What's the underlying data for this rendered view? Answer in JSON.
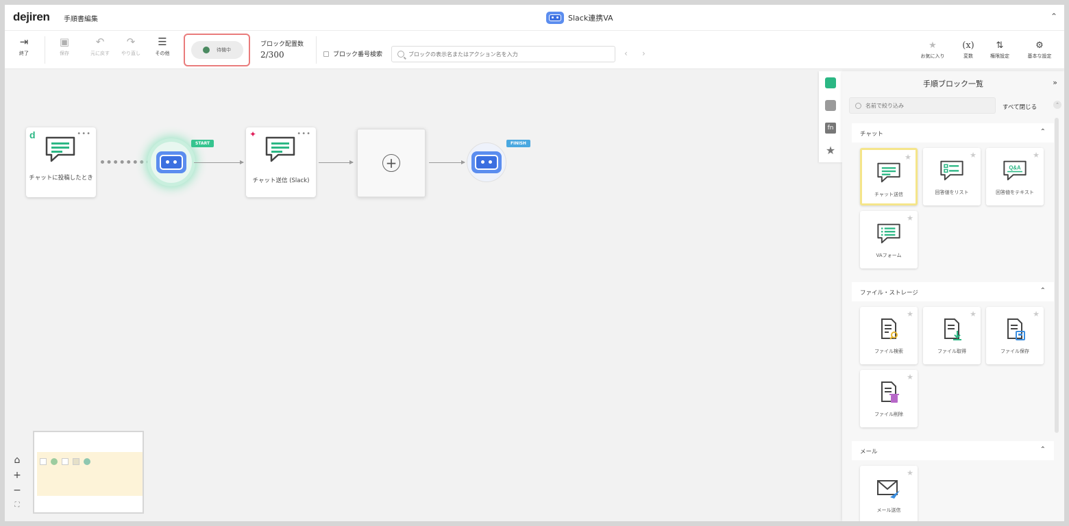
{
  "header": {
    "logo": "dejiren",
    "page_name": "手順書編集",
    "title": "Slack連携VA",
    "collapse_icon": "chevron-up-icon"
  },
  "toolbar": {
    "exit_label": "終了",
    "save_label": "保存",
    "undo_label": "元に戻す",
    "redo_label": "やり直し",
    "more_label": "その他",
    "status_label": "待機中",
    "status_color": "#4b8a61",
    "block_count_label": "ブロック配置数",
    "block_count_value": "2/300",
    "block_search_label": "ブロック番号検索",
    "search_placeholder": "ブロックの表示名またはアクション名を入力",
    "favorites_label": "お気に入り",
    "variables_label": "変数",
    "permission_label": "権限設定",
    "general_settings_label": "基本な設定"
  },
  "canvas": {
    "nodes": [
      {
        "label": "チャットに投稿したとき"
      },
      {
        "tag": "START"
      },
      {
        "label": "チャット送信 (Slack)"
      },
      {
        "tag": "FINISH"
      }
    ],
    "accent_color": "#36c48f",
    "bot_color": "#5b8def"
  },
  "panel": {
    "title": "手順ブロック一覧",
    "search_placeholder": "名前で絞り込み",
    "close_all_label": "すべて閉じる",
    "categories": [
      {
        "name": "チャット",
        "items": [
          {
            "label": "チャット送信"
          },
          {
            "label": "回答値をリスト"
          },
          {
            "label": "回答値をテキスト"
          },
          {
            "label": "VAフォーム"
          }
        ]
      },
      {
        "name": "ファイル・ストレージ",
        "items": [
          {
            "label": "ファイル検索"
          },
          {
            "label": "ファイル取得"
          },
          {
            "label": "ファイル保存"
          },
          {
            "label": "ファイル削除"
          }
        ]
      },
      {
        "name": "メール",
        "items": [
          {
            "label": "メール送信"
          }
        ]
      }
    ]
  }
}
